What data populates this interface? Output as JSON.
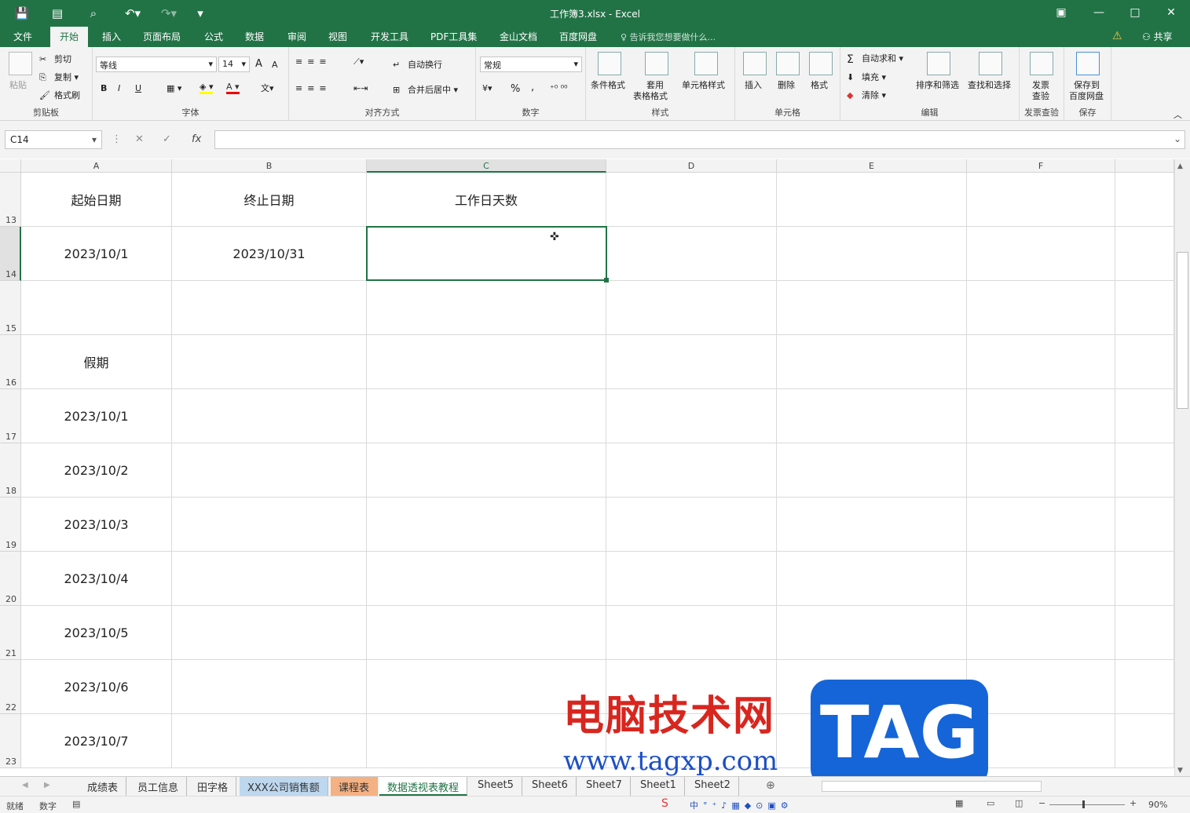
{
  "titlebar": {
    "title": "工作簿3.xlsx - Excel",
    "min": "—",
    "max": "□",
    "close": "✕"
  },
  "menu": {
    "items": [
      "文件",
      "开始",
      "插入",
      "页面布局",
      "公式",
      "数据",
      "审阅",
      "视图",
      "开发工具",
      "PDF工具集",
      "金山文档",
      "百度网盘"
    ],
    "active": "开始",
    "tell": "告诉我您想要做什么...",
    "share": "共享"
  },
  "ribbon": {
    "clipboard": {
      "paste": "粘贴",
      "cut": "剪切",
      "copy": "复制",
      "painter": "格式刷",
      "label": "剪贴板"
    },
    "font": {
      "name": "等线",
      "size": "14",
      "bold": "B",
      "italic": "I",
      "underline": "U",
      "grow": "A",
      "shrink": "A",
      "label": "字体"
    },
    "align": {
      "wrap": "自动换行",
      "merge": "合并后居中",
      "label": "对齐方式"
    },
    "number": {
      "format": "常规",
      "percent": "%",
      "comma": ",",
      "label": "数字"
    },
    "styles": {
      "cond": "条件格式",
      "table1": "套用",
      "table2": "表格格式",
      "cell": "单元格样式",
      "label": "样式"
    },
    "cells": {
      "insert": "插入",
      "delete": "删除",
      "format": "格式",
      "label": "单元格"
    },
    "editing": {
      "autosum": "自动求和",
      "fill": "填充",
      "clear": "清除",
      "sort": "排序和筛选",
      "find": "查找和选择",
      "label": "编辑"
    },
    "invoice": {
      "btn1": "发票",
      "btn2": "查验",
      "label": "发票查验"
    },
    "save": {
      "btn1": "保存到",
      "btn2": "百度网盘",
      "label": "保存"
    }
  },
  "formula_bar": {
    "namebox": "C14",
    "cancel": "✕",
    "enter": "✓",
    "fx": "fx",
    "value": ""
  },
  "columns": [
    "A",
    "B",
    "C",
    "D",
    "E",
    "F"
  ],
  "rows": [
    {
      "num": "13",
      "a": "起始日期",
      "b": "终止日期",
      "c": "工作日天数"
    },
    {
      "num": "14",
      "a": "2023/10/1",
      "b": "2023/10/31",
      "c": ""
    },
    {
      "num": "15",
      "a": "",
      "b": "",
      "c": ""
    },
    {
      "num": "16",
      "a": "假期",
      "b": "",
      "c": ""
    },
    {
      "num": "17",
      "a": "2023/10/1",
      "b": "",
      "c": ""
    },
    {
      "num": "18",
      "a": "2023/10/2",
      "b": "",
      "c": ""
    },
    {
      "num": "19",
      "a": "2023/10/3",
      "b": "",
      "c": ""
    },
    {
      "num": "20",
      "a": "2023/10/4",
      "b": "",
      "c": ""
    },
    {
      "num": "21",
      "a": "2023/10/5",
      "b": "",
      "c": ""
    },
    {
      "num": "22",
      "a": "2023/10/6",
      "b": "",
      "c": ""
    },
    {
      "num": "23",
      "a": "2023/10/7",
      "b": "",
      "c": ""
    }
  ],
  "tabs": [
    "成绩表",
    "员工信息",
    "田字格",
    "XXX公司销售额",
    "课程表",
    "数据透视表教程",
    "Sheet5",
    "Sheet6",
    "Sheet7",
    "Sheet1",
    "Sheet2"
  ],
  "active_tab": "数据透视表教程",
  "status": {
    "ready": "就绪",
    "numlock": "数字",
    "zoom": "90%"
  },
  "watermark": {
    "text1": "电脑技术网",
    "text2": "www.tagxp.com",
    "tag": "TAG"
  },
  "colors": {
    "accent": "#217346",
    "tab_blue": "#bdd7ee",
    "tab_orange": "#f4b183"
  }
}
